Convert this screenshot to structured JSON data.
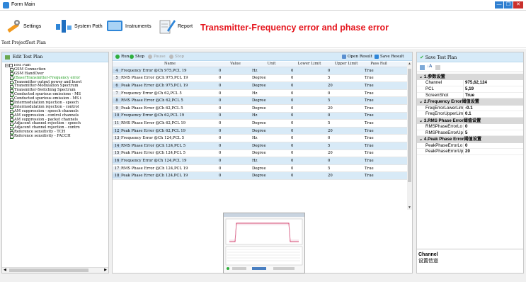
{
  "window": {
    "title": "Form Main",
    "min": "—",
    "max": "❐",
    "close": "✕"
  },
  "toolbar": {
    "settings": "Settings",
    "system_path": "System Path",
    "instruments": "Instruments",
    "report": "Report",
    "headline": "Transmitter-Frequency error and phase error"
  },
  "tabs": [
    "Test Project",
    "Test Plan"
  ],
  "left_panel": {
    "header": "Edit Test Plan",
    "root": "Test Plan",
    "items": [
      {
        "label": "GSM Connection",
        "checked": true
      },
      {
        "label": "GSM HandOver",
        "checked": true
      },
      {
        "label": "(Base)Transmitter-Frequency error",
        "checked": true,
        "highlight": true
      },
      {
        "label": "Transmitter output power and burst",
        "checked": true
      },
      {
        "label": "Transmitter-Modulation Spectrum",
        "checked": true
      },
      {
        "label": "Transmitter-Switching Spectrum",
        "checked": true
      },
      {
        "label": "Conducted spurious emissions - MS",
        "checked": true
      },
      {
        "label": "Conducted spurious emission - MS i",
        "checked": true
      },
      {
        "label": "Intermodulation rejection - speech",
        "checked": true
      },
      {
        "label": "Intermodulation rejection - control",
        "checked": true
      },
      {
        "label": "AM suppression - speech channels",
        "checked": true
      },
      {
        "label": "AM suppression - control channels",
        "checked": true
      },
      {
        "label": "AM suppression - packet channels",
        "checked": true
      },
      {
        "label": "Adjacent channel rejection - speech",
        "checked": true
      },
      {
        "label": "Adjacent channel rejection - contro",
        "checked": true
      },
      {
        "label": "Reference sensitivity - TCH",
        "checked": true
      },
      {
        "label": "Reference sensitivity - FACCH",
        "checked": true
      }
    ]
  },
  "center_toolbar": {
    "run": "Run",
    "step": "Step",
    "pause": "Pause",
    "stop": "Stop",
    "open_result": "Open Result",
    "save_result": "Save Result"
  },
  "grid": {
    "columns": [
      "",
      "Name",
      "Value",
      "Unit",
      "Lower Limit",
      "Upper Limit",
      "Pass Fail"
    ],
    "rows": [
      [
        "4",
        "Frequency Error @Ch 975,PCL 19",
        "0",
        "Hz",
        "0",
        "0",
        "True"
      ],
      [
        "5",
        "RMS Phase Error @Ch 975,PCL 19",
        "0",
        "Degree",
        "0",
        "5",
        "True"
      ],
      [
        "6",
        "Peak Phase Error @Ch 975,PCL 19",
        "0",
        "Degree",
        "0",
        "20",
        "True"
      ],
      [
        "7",
        "Frequency Error @Ch 62,PCL 5",
        "0",
        "Hz",
        "0",
        "0",
        "True"
      ],
      [
        "8",
        "RMS Phase Error @Ch 62,PCL 5",
        "0",
        "Degree",
        "0",
        "5",
        "True"
      ],
      [
        "9",
        "Peak Phase Error @Ch 62,PCL 5",
        "0",
        "Degree",
        "0",
        "20",
        "True"
      ],
      [
        "10",
        "Frequency Error @Ch 62,PCL 19",
        "0",
        "Hz",
        "0",
        "0",
        "True"
      ],
      [
        "11",
        "RMS Phase Error @Ch 62,PCL 19",
        "0",
        "Degree",
        "0",
        "5",
        "True"
      ],
      [
        "12",
        "Peak Phase Error @Ch 62,PCL 19",
        "0",
        "Degree",
        "0",
        "20",
        "True"
      ],
      [
        "13",
        "Frequency Error @Ch 124,PCL 5",
        "0",
        "Hz",
        "0",
        "0",
        "True"
      ],
      [
        "14",
        "RMS Phase Error @Ch 124,PCL 5",
        "0",
        "Degree",
        "0",
        "5",
        "True"
      ],
      [
        "15",
        "Peak Phase Error @Ch 124,PCL 5",
        "0",
        "Degree",
        "0",
        "20",
        "True"
      ],
      [
        "16",
        "Frequency Error @Ch 124,PCL 19",
        "0",
        "Hz",
        "0",
        "0",
        "True"
      ],
      [
        "17",
        "RMS Phase Error @Ch 124,PCL 19",
        "0",
        "Degree",
        "0",
        "5",
        "True"
      ],
      [
        "18",
        "Peak Phase Error @Ch 124,PCL 19",
        "0",
        "Degree",
        "0",
        "20",
        "True"
      ]
    ]
  },
  "right_panel": {
    "header": "Save Test Plan",
    "categories": [
      {
        "title": "1.参数设置",
        "props": [
          {
            "name": "Channel",
            "value": "975,62,124"
          },
          {
            "name": "PCL",
            "value": "5,19"
          },
          {
            "name": "ScreenShot",
            "value": "True"
          }
        ]
      },
      {
        "title": "2.Frequency Error阈值设置",
        "props": [
          {
            "name": "FreqErrorLowerLim",
            "value": "-0.1"
          },
          {
            "name": "FreqErrorUpperLim",
            "value": "0.1"
          }
        ]
      },
      {
        "title": "3.RMS Phase Error阈值设置",
        "props": [
          {
            "name": "RMSPhaseErrorLo",
            "value": "0"
          },
          {
            "name": "RMSPhaseErrorUp",
            "value": "5"
          }
        ]
      },
      {
        "title": "4.Peak Phase Error阈值设置",
        "props": [
          {
            "name": "PeakPhaseErrorLo",
            "value": "0"
          },
          {
            "name": "PeakPhaseErrorUp",
            "value": "20"
          }
        ]
      }
    ],
    "desc_title": "Channel",
    "desc_text": "设置信道"
  },
  "colors": {
    "accent": "#2f86d8",
    "headline": "#e5151d",
    "panel_header": "#d6eaf8",
    "row_alt": "#d8eaf7"
  }
}
